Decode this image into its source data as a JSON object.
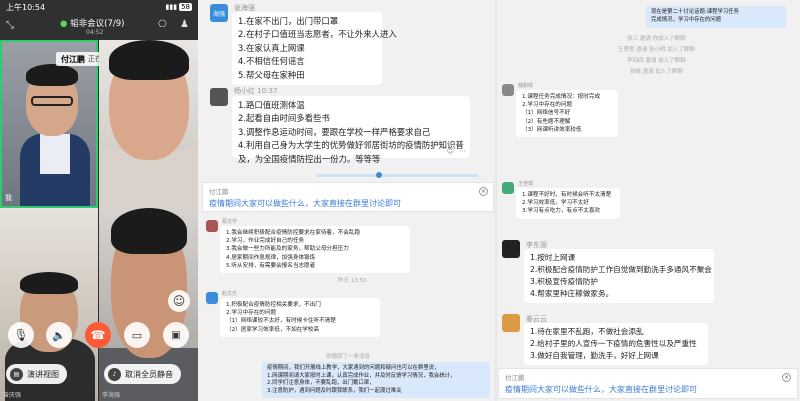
{
  "call": {
    "status_time": "上午10:54",
    "status_battery": "58",
    "meeting_title": "韬非会议(7/9)",
    "meeting_timer": "04:52",
    "speaker_name": "付江鹏",
    "speaker_status": "正在发言",
    "tile_label_me": "我",
    "tile_label_bottom_left": "曾庆强",
    "tile_label_bottom_right": "李海强",
    "btn_present": "演讲视图",
    "btn_mute_all": "取消全员静音",
    "accent_end_call": "#ff5a36"
  },
  "chat": {
    "left_top": {
      "sender": "张海强",
      "avatar_text": "海强",
      "lines": [
        "1.在家不出门，出门带口罩",
        "2.在村子口值班当志愿者，不让外来人进入",
        "3.在家认真上网课",
        "4.不相信任何谣言",
        "5.帮父母在家种田"
      ]
    },
    "left_second": {
      "sender": "杨小红",
      "time": "10:37",
      "lines": [
        "1.路口值班测体温",
        "2.起看自由时间多看些书",
        "3.调整作息运动时间，要跟在学校一样严格要求自己",
        "4.利用自己身为大学生的优势做好邻居街坊的疫情防护知识普",
        "及，为全国疫情防控出一份力。等等等"
      ]
    },
    "left_input": {
      "name": "付江鹏",
      "hint": "疫情期间大家可以做些什么，大家直接在群里讨论即可"
    },
    "left_lower": {
      "sender": "蔡文宇",
      "lines": [
        "1.我会继续积极配合疫情防控要求在家待着，不会乱跑",
        "2.学习，作业完成好自己的任务",
        "3.我会做一些力所能及的家务，帮助父母分担压力",
        "4.居家期间作息规律，加强身体锻炼",
        "5.听从安排，有需要会报名当志愿者"
      ]
    },
    "left_time_mid": "昨天 13:55",
    "left_bottom_msg": {
      "sender": "赵文乐",
      "lines": [
        "1.积极配合疫情防控相关要求，不出门",
        "2.学习中存在的问题",
        "（1）网络课较不太好，有时候卡住听不清楚",
        "（2）居家学习效率低，不如在学校高"
      ]
    },
    "left_recall": "你撤回了一条消息",
    "left_blue": {
      "lines": [
        "疫情期间，我们开展线上教学，大家遇到的问题和疑问也可以在群里说，",
        "1.网课期间请大家按时上课，认真完成作业，并及时反馈学习情况，我会统计，",
        "2.同学们注意身体，不要乱跑，出门戴口罩，",
        "3.注意防护，遇到问题及时跟我联系，我们一起渡过难关"
      ]
    },
    "right_top_blue": {
      "lines": [
        "现在是第二十讨论话题:课程学习任务",
        "完成情况，学习中存在的问题"
      ]
    },
    "right_grey_lines": [
      "张三 邀请 你加入了群聊",
      "王思思 邀请 张小明 加入了群聊",
      "李四四 邀请 加入了群聊",
      "刘晓 邀请 加入了群聊"
    ],
    "right_small_msg": {
      "sender": "薛鹏辉",
      "lines": [
        "1.课程任务完成情况：按时完成",
        "2.学习中存在的问题",
        "（1）网络信号不好",
        "（2）有些题不理解",
        "（3）网课听讲效率较低"
      ]
    },
    "right_mid_msg": {
      "sender": "王佳琪",
      "lines": [
        "1.课程不好时，有时候会听不太清楚",
        "2.学习效率低，学习不太好",
        "3.学习有点吃力，有点不太喜欢"
      ]
    },
    "right_big1": {
      "sender": "李东源",
      "lines": [
        "1.按时上网课",
        "2.积极配合疫情防护工作自觉做到勤洗手多通风不聚会",
        "3.积极宣传疫情防护",
        "4.帮家里种庄稼做家务。"
      ]
    },
    "right_big2": {
      "sender": "姜云云",
      "lines": [
        "1.待在家里不乱跑，不做社会添乱",
        "2.给村子里的人宣传一下疫情的危害性以及严重性",
        "3.做好自我管理，勤洗手，好好上网课"
      ]
    },
    "right_input": {
      "name": "付江鹏",
      "hint": "疫情期间大家可以做些什么，大家直接在群里讨论即可"
    }
  }
}
